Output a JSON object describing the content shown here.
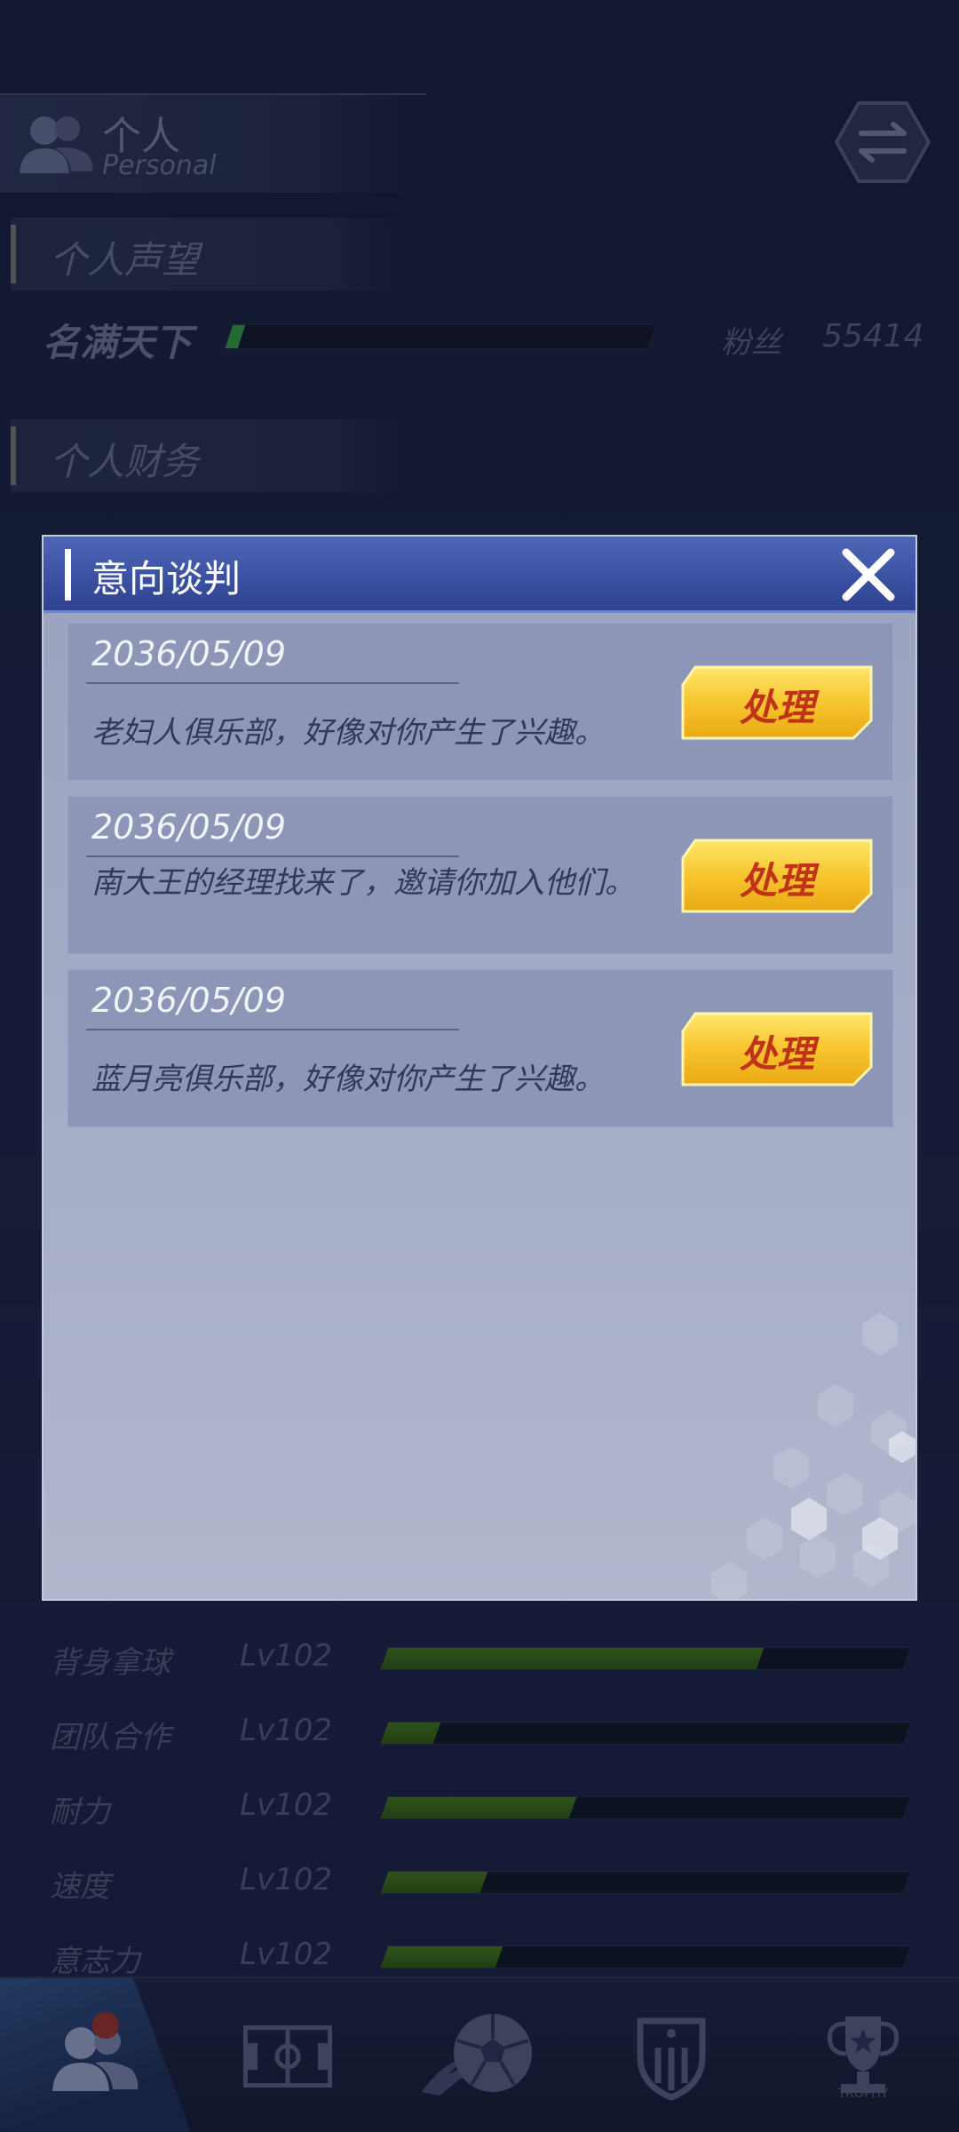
{
  "header": {
    "title": "个人",
    "subtitle": "Personal"
  },
  "reputation": {
    "section_title": "个人声望",
    "rank_title": "名满天下",
    "progress": 0.03,
    "fans_label": "粉丝",
    "fans_value": "55414"
  },
  "finance": {
    "section_title": "个人财务"
  },
  "stats": [
    {
      "name": "背身拿球",
      "level": "Lv102",
      "progress": 0.72
    },
    {
      "name": "团队合作",
      "level": "Lv102",
      "progress": 0.1
    },
    {
      "name": "耐力",
      "level": "Lv102",
      "progress": 0.36
    },
    {
      "name": "速度",
      "level": "Lv102",
      "progress": 0.19
    },
    {
      "name": "意志力",
      "level": "Lv102",
      "progress": 0.22
    }
  ],
  "nav": {
    "items": [
      "personal-icon",
      "pitch-icon",
      "football-icon",
      "club-badge-icon",
      "trophy-icon"
    ],
    "trophy_text": "TROPHY",
    "active": 0
  },
  "modal": {
    "title": "意向谈判",
    "items": [
      {
        "date": "2036/05/09",
        "text": "老妇人俱乐部，好像对你产生了兴趣。",
        "button": "处理"
      },
      {
        "date": "2036/05/09",
        "text": "南大王的经理找来了，邀请你加入他们。",
        "button": "处理"
      },
      {
        "date": "2036/05/09",
        "text": "蓝月亮俱乐部，好像对你产生了兴趣。",
        "button": "处理"
      }
    ]
  },
  "colors": {
    "modal_header": "#3a4fa0",
    "button_gold": "#f6c531",
    "button_text": "#c0321a"
  }
}
